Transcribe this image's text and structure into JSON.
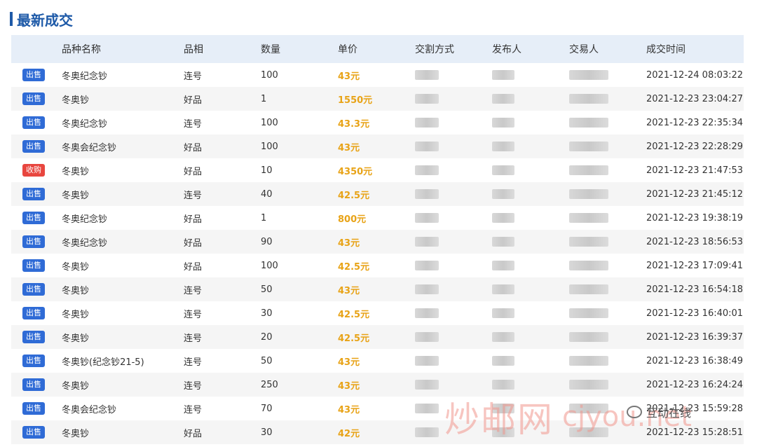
{
  "title": "最新成交",
  "headers": [
    "",
    "品种名称",
    "品相",
    "数量",
    "单价",
    "交割方式",
    "发布人",
    "交易人",
    "成交时间"
  ],
  "rows": [
    {
      "type": "出售",
      "kind": "sell",
      "name": "冬奥纪念钞",
      "grade": "连号",
      "qty": "100",
      "price": "43元",
      "time": "2021-12-24 08:03:22"
    },
    {
      "type": "出售",
      "kind": "sell",
      "name": "冬奥钞",
      "grade": "好品",
      "qty": "1",
      "price": "1550元",
      "time": "2021-12-23 23:04:27"
    },
    {
      "type": "出售",
      "kind": "sell",
      "name": "冬奥纪念钞",
      "grade": "连号",
      "qty": "100",
      "price": "43.3元",
      "time": "2021-12-23 22:35:34"
    },
    {
      "type": "出售",
      "kind": "sell",
      "name": "冬奥会纪念钞",
      "grade": "好品",
      "qty": "100",
      "price": "43元",
      "time": "2021-12-23 22:28:29"
    },
    {
      "type": "收购",
      "kind": "buy",
      "name": "冬奥钞",
      "grade": "好品",
      "qty": "10",
      "price": "4350元",
      "time": "2021-12-23 21:47:53"
    },
    {
      "type": "出售",
      "kind": "sell",
      "name": "冬奥钞",
      "grade": "连号",
      "qty": "40",
      "price": "42.5元",
      "time": "2021-12-23 21:45:12"
    },
    {
      "type": "出售",
      "kind": "sell",
      "name": "冬奥纪念钞",
      "grade": "好品",
      "qty": "1",
      "price": "800元",
      "time": "2021-12-23 19:38:19"
    },
    {
      "type": "出售",
      "kind": "sell",
      "name": "冬奥纪念钞",
      "grade": "好品",
      "qty": "90",
      "price": "43元",
      "time": "2021-12-23 18:56:53"
    },
    {
      "type": "出售",
      "kind": "sell",
      "name": "冬奥钞",
      "grade": "好品",
      "qty": "100",
      "price": "42.5元",
      "time": "2021-12-23 17:09:41"
    },
    {
      "type": "出售",
      "kind": "sell",
      "name": "冬奥钞",
      "grade": "连号",
      "qty": "50",
      "price": "43元",
      "time": "2021-12-23 16:54:18"
    },
    {
      "type": "出售",
      "kind": "sell",
      "name": "冬奥钞",
      "grade": "连号",
      "qty": "30",
      "price": "42.5元",
      "time": "2021-12-23 16:40:01"
    },
    {
      "type": "出售",
      "kind": "sell",
      "name": "冬奥钞",
      "grade": "连号",
      "qty": "20",
      "price": "42.5元",
      "time": "2021-12-23 16:39:37"
    },
    {
      "type": "出售",
      "kind": "sell",
      "name": "冬奥钞(纪念钞21-5)",
      "grade": "连号",
      "qty": "50",
      "price": "43元",
      "time": "2021-12-23 16:38:49"
    },
    {
      "type": "出售",
      "kind": "sell",
      "name": "冬奥钞",
      "grade": "连号",
      "qty": "250",
      "price": "43元",
      "time": "2021-12-23 16:24:24"
    },
    {
      "type": "出售",
      "kind": "sell",
      "name": "冬奥会纪念钞",
      "grade": "连号",
      "qty": "70",
      "price": "43元",
      "time": "2021-12-23 15:59:28"
    },
    {
      "type": "出售",
      "kind": "sell",
      "name": "冬奥钞",
      "grade": "好品",
      "qty": "30",
      "price": "42元",
      "time": "2021-12-23 15:28:51"
    }
  ],
  "watermark": {
    "cn": "炒邮网",
    "en": "cjyou.net",
    "wechat": "互动在线"
  },
  "colors": {
    "title": "#1e5aa8",
    "header_bg": "#e6eef8",
    "sell": "#2f6bd6",
    "buy": "#e8463f",
    "price": "#e8a317"
  }
}
